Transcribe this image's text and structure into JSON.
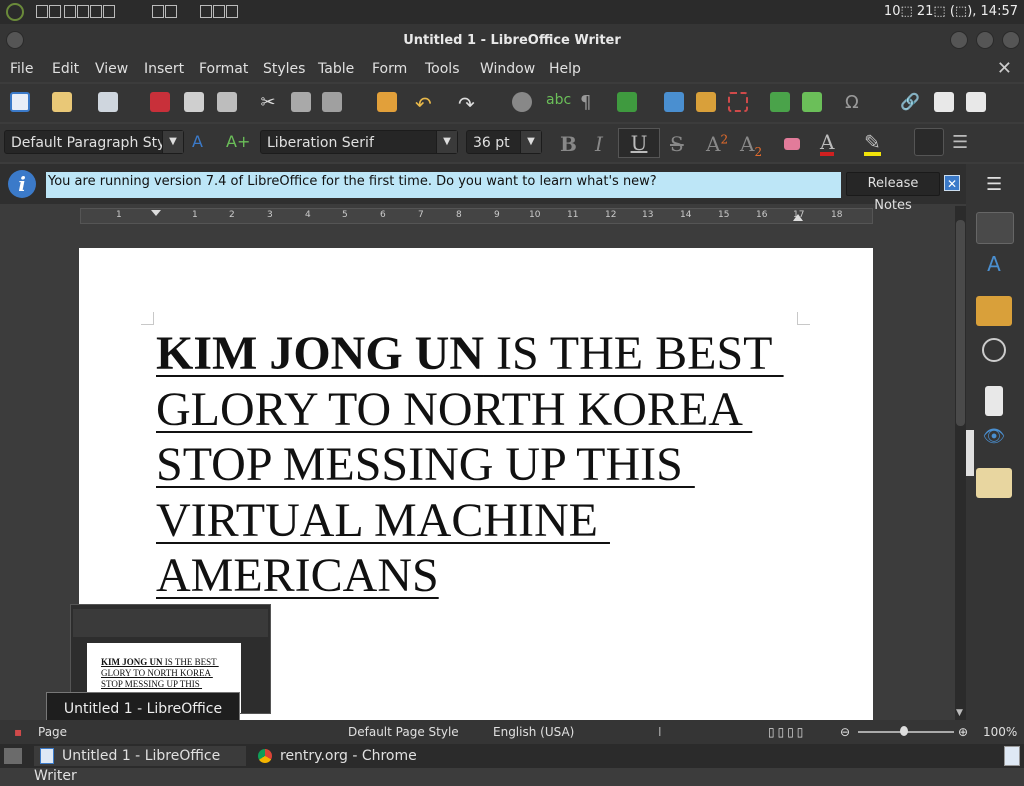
{
  "system_bar": {
    "clock": "10⬚ 21⬚ (⬚), 14:57"
  },
  "window": {
    "title": "Untitled 1 - LibreOffice Writer"
  },
  "menu": {
    "items": [
      "File",
      "Edit",
      "View",
      "Insert",
      "Format",
      "Styles",
      "Table",
      "Form",
      "Tools",
      "Window",
      "Help"
    ]
  },
  "formatting": {
    "paragraph_style": "Default Paragraph Style",
    "font_name": "Liberation Serif",
    "font_size": "36 pt"
  },
  "infobar": {
    "message": "You are running version 7.4 of LibreOffice for the first time. Do you want to learn what's new?",
    "button_label": "Release Notes"
  },
  "ruler": {
    "labels": [
      "1",
      "1",
      "2",
      "3",
      "4",
      "5",
      "6",
      "7",
      "8",
      "9",
      "10",
      "11",
      "12",
      "13",
      "14",
      "15",
      "16",
      "17",
      "18"
    ]
  },
  "document": {
    "bold_part": "KIM JONG UN",
    "line1_rest": " IS THE BEST ",
    "line2": "GLORY TO NORTH KOREA ",
    "line3": "STOP MESSING UP THIS ",
    "line4": "VIRTUAL MACHINE ",
    "line5": "AMERICANS"
  },
  "preview": {
    "bold_part": "KIM JONG UN",
    "line1_rest": " IS THE BEST ",
    "line2": "GLORY TO NORTH KOREA ",
    "line3": "STOP MESSING UP THIS ",
    "tooltip": "Untitled 1 - LibreOffice Writer"
  },
  "statusbar": {
    "page": "Page",
    "page_style": "Default Page Style",
    "language": "English (USA)",
    "zoom": "100%"
  },
  "taskbar": {
    "tasks": [
      {
        "label": "Untitled 1 - LibreOffice Writer",
        "active": true
      },
      {
        "label": "rentry.org - Chrome",
        "active": false
      }
    ]
  },
  "colors": {
    "infobar_bg": "#bde6f7",
    "accent": "#3b7ac9"
  }
}
